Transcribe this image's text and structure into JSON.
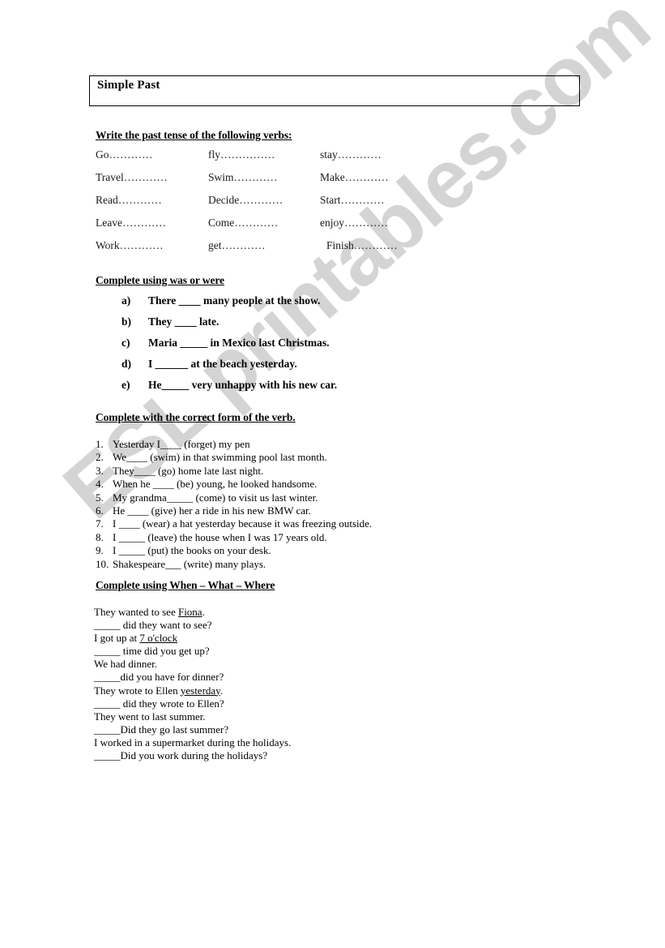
{
  "document": {
    "title": "Simple Past",
    "background_color": "#ffffff",
    "text_color": "#000000"
  },
  "watermark": {
    "text": "ESL printables.com",
    "color": "#d4d4d4"
  },
  "sections": {
    "verbs": {
      "heading": "Write the past tense of the following verbs:",
      "rows": [
        {
          "c0": "Go…………",
          "c1": "fly……………",
          "c2": "stay…………"
        },
        {
          "c0": "Travel…………",
          "c1": "Swim…………",
          "c2": "Make…………"
        },
        {
          "c0": "Read…………",
          "c1": "Decide…………",
          "c2": "Start…………"
        },
        {
          "c0": "Leave…………",
          "c1": "Come…………",
          "c2": "enjoy…………"
        },
        {
          "c0": "Work…………",
          "c1": "get…………",
          "c2": "Finish…………"
        }
      ]
    },
    "was_were": {
      "heading": "Complete using was or were",
      "items": [
        {
          "marker": "a)",
          "text": "There ____ many people at the show."
        },
        {
          "marker": "b)",
          "text": "They ____ late."
        },
        {
          "marker": "c)",
          "text": "Maria _____ in Mexico last Christmas."
        },
        {
          "marker": "d)",
          "text": "I ______ at the beach yesterday."
        },
        {
          "marker": "e)",
          "text": "He_____ very unhappy with his new car."
        }
      ]
    },
    "verb_form": {
      "heading": "Complete with the correct form of the verb.",
      "items": [
        {
          "num": "1.",
          "text": "Yesterday I____ (forget) my pen"
        },
        {
          "num": "2.",
          "text": "We____ (swim) in that swimming pool last month."
        },
        {
          "num": "3.",
          "text": "They____ (go) home late last night."
        },
        {
          "num": "4.",
          "text": "When he ____ (be) young, he looked handsome."
        },
        {
          "num": "5.",
          "text": "My grandma_____ (come) to visit us last winter."
        },
        {
          "num": "6.",
          "text": "He ____ (give) her a ride in his new BMW car."
        },
        {
          "num": "7.",
          "text": "I ____ (wear) a hat yesterday because it was freezing outside."
        },
        {
          "num": "8.",
          "text": "I _____ (leave) the house when I was 17 years old."
        },
        {
          "num": "9.",
          "text": "I _____ (put) the books on your desk."
        },
        {
          "num": "10.",
          "text": "Shakespeare___ (write) many plays."
        }
      ]
    },
    "when_what_where": {
      "heading": "Complete using When – What – Where",
      "lines": [
        {
          "before": "They wanted to see ",
          "underlined": "Fiona",
          "after": "."
        },
        {
          "before": "_____ did they want to see?",
          "underlined": "",
          "after": ""
        },
        {
          "before": "I got up at ",
          "underlined": "7 o'clock   ",
          "after": ""
        },
        {
          "before": "_____  time did you get up?",
          "underlined": "",
          "after": ""
        },
        {
          "before": "We had dinner.",
          "underlined": "",
          "after": ""
        },
        {
          "before": "_____did you have for dinner?",
          "underlined": "",
          "after": ""
        },
        {
          "before": "They wrote to Ellen ",
          "underlined": "yesterday",
          "after": "."
        },
        {
          "before": "_____ did they wrote to Ellen?",
          "underlined": "",
          "after": ""
        },
        {
          "before": "They went to last summer.",
          "underlined": "",
          "after": ""
        },
        {
          "before": "_____Did they go last summer?",
          "underlined": "",
          "after": ""
        },
        {
          "before": "I worked in a supermarket during the holidays.",
          "underlined": "",
          "after": ""
        },
        {
          "before": "_____Did you work during the holidays?",
          "underlined": "",
          "after": ""
        }
      ]
    }
  }
}
